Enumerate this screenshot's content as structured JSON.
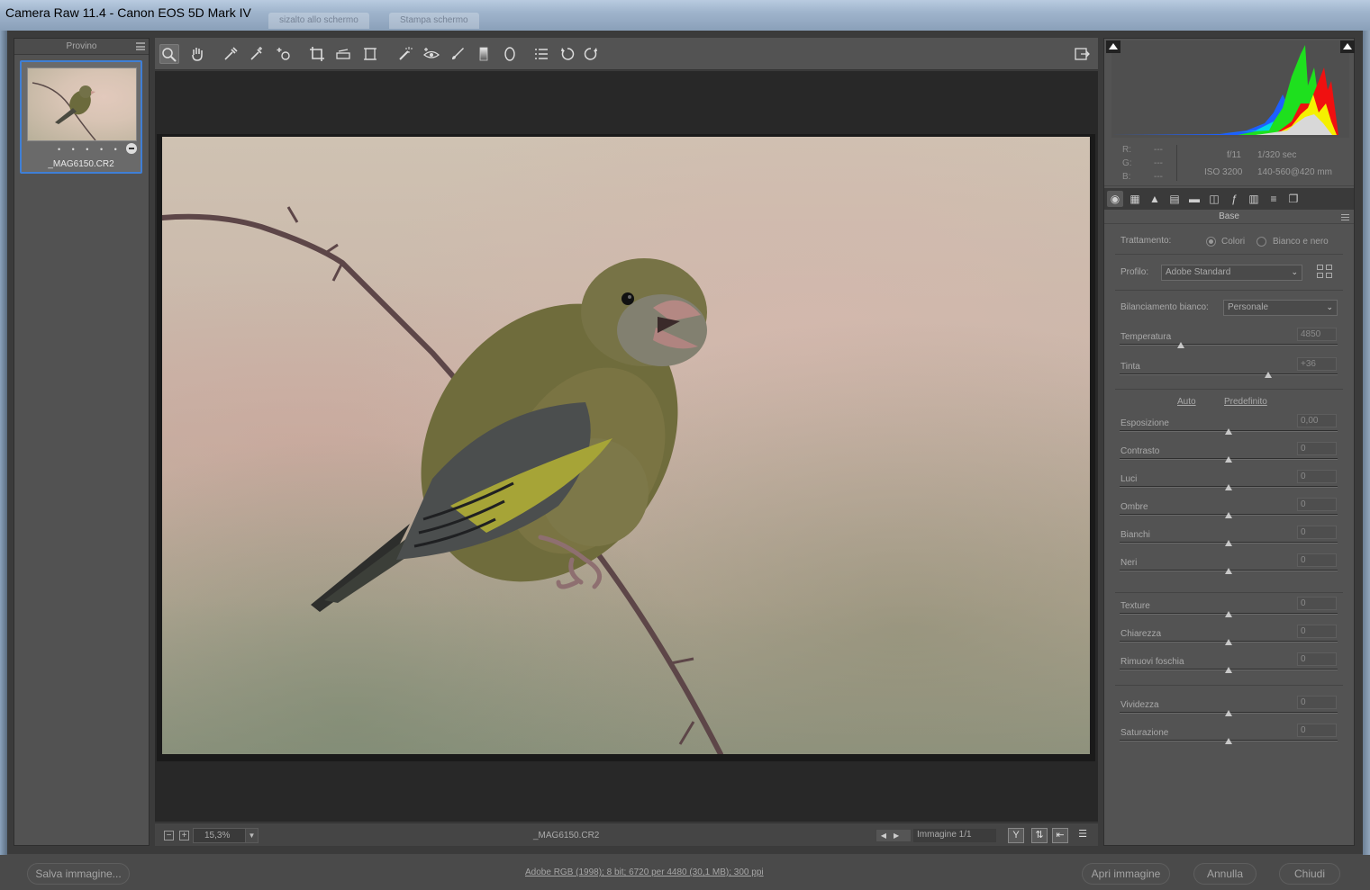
{
  "window": {
    "title": "Camera Raw 11.4  -  Canon EOS 5D Mark IV",
    "ghost_tabs": [
      "sizalto allo schermo",
      "Stampa schermo"
    ]
  },
  "filmstrip": {
    "header": "Provino",
    "dots": "• • • • •",
    "file_name": "_MAG6150.CR2"
  },
  "toolbar": {
    "icons": [
      "zoom-icon",
      "hand-icon",
      "white-balance-icon",
      "color-sampler-icon",
      "targeted-adjustment-icon",
      "crop-icon",
      "straighten-icon",
      "transform-icon",
      "spot-removal-icon",
      "red-eye-icon",
      "adjustment-brush-icon",
      "graduated-filter-icon",
      "radial-filter-icon",
      "presets-list-icon",
      "rotate-left-icon",
      "rotate-right-icon",
      "open-preferences-icon"
    ]
  },
  "preview_bar": {
    "zoom": "15,3%",
    "file_name": "_MAG6150.CR2",
    "image_count": "Immagine 1/1"
  },
  "info": {
    "r_label": "R:",
    "g_label": "G:",
    "b_label": "B:",
    "r_val": "---",
    "g_val": "---",
    "b_val": "---",
    "aperture": "f/11",
    "shutter": "1/320 sec",
    "iso": "ISO 3200",
    "lens": "140-560@420 mm"
  },
  "panel": {
    "title": "Base",
    "trattamento_label": "Trattamento:",
    "colori": "Colori",
    "bianco_nero": "Bianco e nero",
    "profilo_label": "Profilo:",
    "profilo_value": "Adobe Standard",
    "bilanciamento_label": "Bilanciamento bianco:",
    "bilanciamento_value": "Personale",
    "auto": "Auto",
    "predefinito": "Predefinito",
    "sliders": [
      {
        "label": "Temperatura",
        "value": "4850",
        "pos": 0.28
      },
      {
        "label": "Tinta",
        "value": "+36",
        "pos": 0.68
      },
      {
        "label": "Esposizione",
        "value": "0,00",
        "pos": 0.5
      },
      {
        "label": "Contrasto",
        "value": "0",
        "pos": 0.5
      },
      {
        "label": "Luci",
        "value": "0",
        "pos": 0.5
      },
      {
        "label": "Ombre",
        "value": "0",
        "pos": 0.5
      },
      {
        "label": "Bianchi",
        "value": "0",
        "pos": 0.5
      },
      {
        "label": "Neri",
        "value": "0",
        "pos": 0.5
      },
      {
        "label": "Texture",
        "value": "0",
        "pos": 0.5
      },
      {
        "label": "Chiarezza",
        "value": "0",
        "pos": 0.5
      },
      {
        "label": "Rimuovi foschia",
        "value": "0",
        "pos": 0.5
      },
      {
        "label": "Vividezza",
        "value": "0",
        "pos": 0.5
      },
      {
        "label": "Saturazione",
        "value": "0",
        "pos": 0.5
      }
    ]
  },
  "bottom": {
    "save": "Salva immagine...",
    "file_info": "Adobe RGB (1998); 8 bit; 6720 per 4480 (30,1 MB); 300 ppi",
    "open": "Apri immagine",
    "cancel": "Annulla",
    "close": "Chiudi"
  }
}
